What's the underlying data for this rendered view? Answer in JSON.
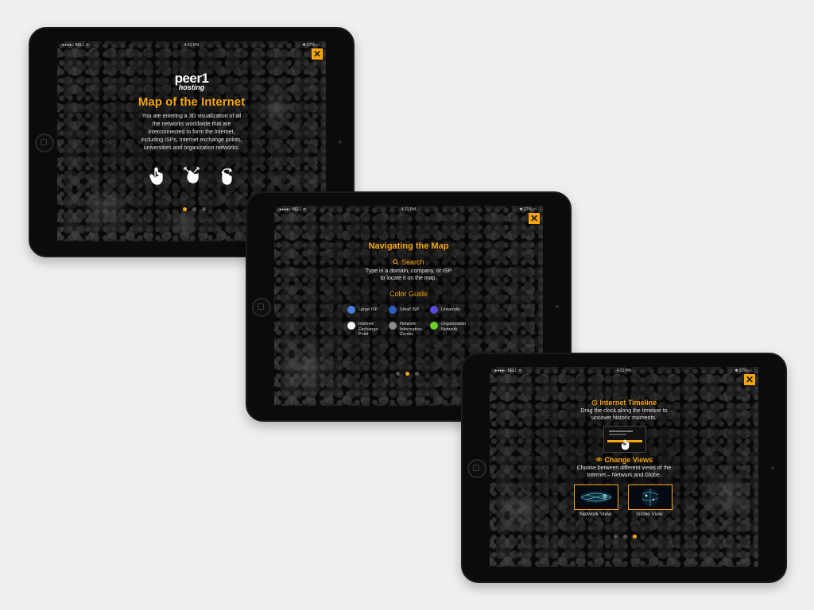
{
  "colors": {
    "accent": "#f6a511",
    "background": "#efefef",
    "device": "#0b0b0b"
  },
  "status_bar": {
    "carrier": "●●●●○ BELL ᯤ",
    "time": "4:21 PM",
    "battery": "✱ 22% ▭"
  },
  "close_icon": "close-icon",
  "screen1": {
    "logo_main": "peer1",
    "logo_sub": "hosting",
    "title": "Map of the Internet",
    "body_lines": [
      "You are entering a 3D visualization of all",
      "the networks worldwide that are",
      "interconnected to form the Internet,",
      "including ISPs, Internet exchange points,",
      "universities and organization networks."
    ],
    "gesture_icons": [
      "tap-gesture-icon",
      "pinch-gesture-icon",
      "rotate-gesture-icon"
    ],
    "page_indicator": {
      "total": 3,
      "active": 1
    }
  },
  "screen2": {
    "title": "Navigating the Map",
    "search_heading": "Search",
    "search_icon": "search-icon",
    "search_lines": [
      "Type in a domain, company, or ISP",
      "to locate it on the map."
    ],
    "color_guide_heading": "Color Guide",
    "legend": [
      {
        "label_lines": [
          "Large ISP"
        ],
        "color": "#4a7fe0"
      },
      {
        "label_lines": [
          "Small ISP"
        ],
        "color": "#2f5fc4"
      },
      {
        "label_lines": [
          "University"
        ],
        "color": "#5a4be0"
      },
      {
        "label_lines": [
          "Internet",
          "Exchange",
          "Point"
        ],
        "color": "#ffffff"
      },
      {
        "label_lines": [
          "Network",
          "Information",
          "Center"
        ],
        "color": "#8a8a8a"
      },
      {
        "label_lines": [
          "Organization",
          "Network"
        ],
        "color": "#6ccf2a"
      }
    ],
    "page_indicator": {
      "total": 3,
      "active": 2
    }
  },
  "screen3": {
    "timeline_heading": "Internet Timeline",
    "timeline_icon": "clock-icon",
    "timeline_lines": [
      "Drag the clock along the timeline to",
      "uncover historic moments."
    ],
    "views_heading": "Change Views",
    "views_icon": "eye-icon",
    "views_lines": [
      "Choose between different views of the",
      "Internet – Network and Globe."
    ],
    "network_view_label": "Network View",
    "globe_view_label": "Globe View",
    "page_indicator": {
      "total": 3,
      "active": 3
    }
  }
}
